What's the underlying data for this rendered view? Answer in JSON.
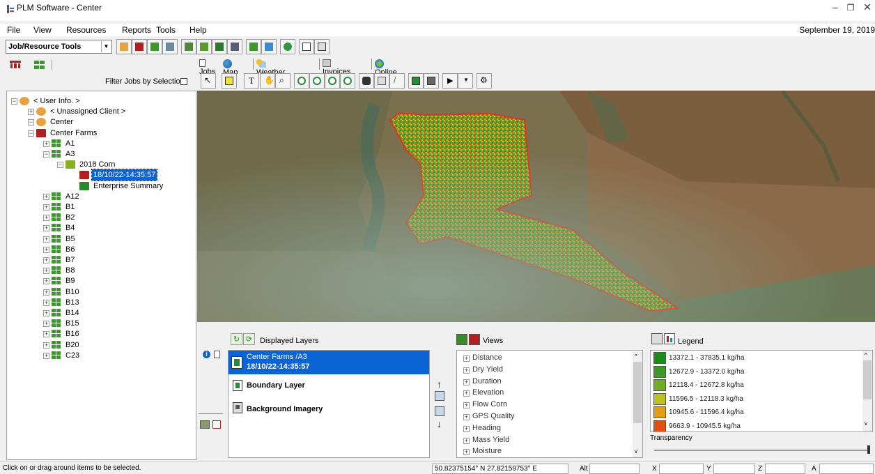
{
  "window": {
    "title": "PLM Software - Center"
  },
  "menu": [
    "File",
    "View",
    "Resources",
    "Reports",
    "Tools",
    "Help"
  ],
  "date": "September 19, 2019",
  "toolbar": {
    "selector": "Job/Resource Tools"
  },
  "left": {
    "filter_label": "Filter Jobs by Selection",
    "tree": [
      {
        "label": "< User Info. >",
        "level": 0,
        "expander": "−",
        "icon": "users-icon"
      },
      {
        "label": "< Unassigned Client >",
        "level": 1,
        "expander": "+",
        "icon": "user-icon"
      },
      {
        "label": "Center",
        "level": 1,
        "expander": "−",
        "icon": "user-icon"
      },
      {
        "label": "Center Farms",
        "level": 2,
        "expander": "−",
        "icon": "farm-icon"
      },
      {
        "label": "A1",
        "level": 3,
        "expander": "+",
        "icon": "field-icon"
      },
      {
        "label": "A3",
        "level": 3,
        "expander": "−",
        "icon": "field-icon"
      },
      {
        "label": "2018 Corn",
        "level": 4,
        "expander": "−",
        "icon": "crop-icon"
      },
      {
        "label": "18/10/22-14:35:57",
        "level": 5,
        "expander": "",
        "icon": "job-icon",
        "selected": true
      },
      {
        "label": "Enterprise Summary",
        "level": 5,
        "expander": "",
        "icon": "summary-icon"
      },
      {
        "label": "A12",
        "level": 3,
        "expander": "+",
        "icon": "field-icon"
      },
      {
        "label": "B1",
        "level": 3,
        "expander": "+",
        "icon": "field-icon"
      },
      {
        "label": "B2",
        "level": 3,
        "expander": "+",
        "icon": "field-icon"
      },
      {
        "label": "B4",
        "level": 3,
        "expander": "+",
        "icon": "field-icon"
      },
      {
        "label": "B5",
        "level": 3,
        "expander": "+",
        "icon": "field-icon"
      },
      {
        "label": "B6",
        "level": 3,
        "expander": "+",
        "icon": "field-icon"
      },
      {
        "label": "B7",
        "level": 3,
        "expander": "+",
        "icon": "field-icon"
      },
      {
        "label": "B8",
        "level": 3,
        "expander": "+",
        "icon": "field-icon"
      },
      {
        "label": "B9",
        "level": 3,
        "expander": "+",
        "icon": "field-icon"
      },
      {
        "label": "B10",
        "level": 3,
        "expander": "+",
        "icon": "field-icon"
      },
      {
        "label": "B13",
        "level": 3,
        "expander": "+",
        "icon": "field-icon"
      },
      {
        "label": "B14",
        "level": 3,
        "expander": "+",
        "icon": "field-icon"
      },
      {
        "label": "B15",
        "level": 3,
        "expander": "+",
        "icon": "field-icon"
      },
      {
        "label": "B16",
        "level": 3,
        "expander": "+",
        "icon": "field-icon"
      },
      {
        "label": "B20",
        "level": 3,
        "expander": "+",
        "icon": "field-icon"
      },
      {
        "label": "C23",
        "level": 3,
        "expander": "+",
        "icon": "field-icon"
      }
    ]
  },
  "tabs": [
    {
      "label": "Jobs",
      "icon": "jobs-icon"
    },
    {
      "label": "Map",
      "icon": "globe-icon",
      "active": true
    },
    {
      "label": "Weather",
      "icon": "weather-icon"
    },
    {
      "label": "Invoices",
      "icon": "invoices-icon"
    },
    {
      "label": "Online",
      "icon": "online-icon"
    }
  ],
  "layers": {
    "title": "Displayed Layers",
    "items": [
      {
        "line1": "Center Farms /A3",
        "line2": "18/10/22-14:35:57",
        "selected": true
      },
      {
        "line1": "Boundary Layer"
      },
      {
        "line1": "Background Imagery"
      }
    ]
  },
  "views": {
    "title": "Views",
    "items": [
      "Distance",
      "Dry Yield",
      "Duration",
      "Elevation",
      "Flow Corn",
      "GPS Quality",
      "Heading",
      "Mass Yield",
      "Moisture"
    ]
  },
  "legend": {
    "title": "Legend",
    "items": [
      {
        "label": "13372.1 - 37835.1 kg/ha",
        "color": "#1e8a1e"
      },
      {
        "label": "12672.9 - 13372.0 kg/ha",
        "color": "#3d9a28"
      },
      {
        "label": "12118.4 - 12672.8 kg/ha",
        "color": "#6fae22"
      },
      {
        "label": "11596.5 - 12118.3 kg/ha",
        "color": "#b9c21e"
      },
      {
        "label": "10945.6 - 11596.4 kg/ha",
        "color": "#e0a016"
      },
      {
        "label": "9663.9 - 10945.5 kg/ha",
        "color": "#e05014"
      }
    ],
    "transparency_label": "Transparency"
  },
  "status": {
    "message": "Click on or drag around items to be selected.",
    "coords": "50.82375154° N  27.82159753° E",
    "alt_label": "Alt",
    "x_label": "X",
    "y_label": "Y",
    "z_label": "Z",
    "a_label": "A"
  }
}
